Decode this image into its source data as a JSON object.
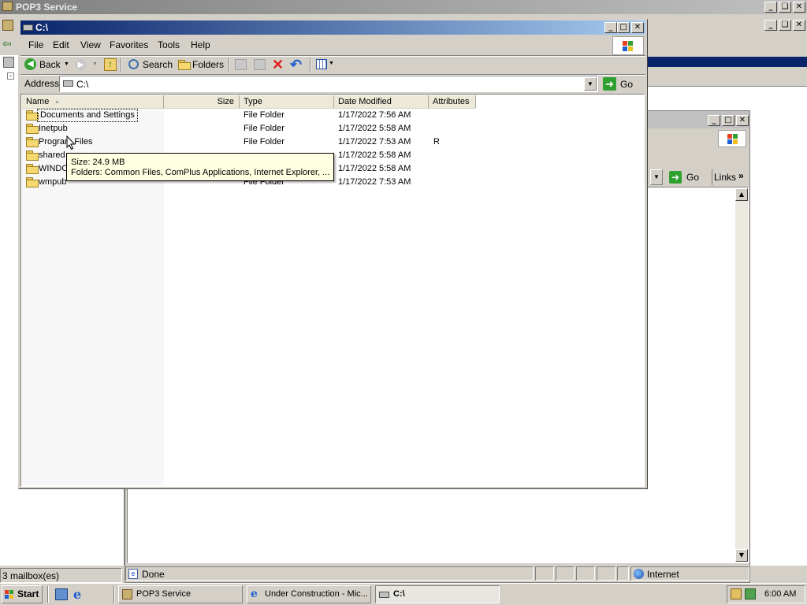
{
  "pop3_window": {
    "title": "POP3 Service",
    "status": "3 mailbox(es)"
  },
  "explorer": {
    "title": "C:\\",
    "menu": [
      "File",
      "Edit",
      "View",
      "Favorites",
      "Tools",
      "Help"
    ],
    "toolbar": {
      "back_label": "Back",
      "search_label": "Search",
      "folders_label": "Folders"
    },
    "address": {
      "label": "Address",
      "value": "C:\\",
      "go_label": "Go"
    },
    "columns": [
      "Name",
      "Size",
      "Type",
      "Date Modified",
      "Attributes"
    ],
    "rows": [
      {
        "name": "Documents and Settings",
        "size": "",
        "type": "File Folder",
        "modified": "1/17/2022 7:56 AM",
        "attributes": ""
      },
      {
        "name": "Inetpub",
        "size": "",
        "type": "File Folder",
        "modified": "1/17/2022 5:58 AM",
        "attributes": ""
      },
      {
        "name": "Program Files",
        "size": "",
        "type": "File Folder",
        "modified": "1/17/2022 7:53 AM",
        "attributes": "R"
      },
      {
        "name": "shared",
        "size": "",
        "type": "",
        "modified": "1/17/2022 5:58 AM",
        "attributes": ""
      },
      {
        "name": "WINDO",
        "size": "",
        "type": "",
        "modified": "1/17/2022 5:58 AM",
        "attributes": ""
      },
      {
        "name": "wmpub",
        "size": "",
        "type": "File Folder",
        "modified": "1/17/2022 7:53 AM",
        "attributes": ""
      }
    ],
    "tooltip": {
      "line1": "Size: 24.9 MB",
      "line2": "Folders: Common Files, ComPlus Applications, Internet Explorer, ..."
    }
  },
  "ie_window": {
    "go_label": "Go",
    "links_label": "Links",
    "status_text": "Done",
    "zone_text": "Internet"
  },
  "taskbar": {
    "start_label": "Start",
    "buttons": [
      "POP3 Service",
      "Under Construction - Mic...",
      "C:\\"
    ],
    "clock": "6:00 AM"
  },
  "colors": {
    "title_active_start": "#0a246a",
    "title_active_end": "#a6caf0",
    "title_inactive": "#808080",
    "face": "#d4d0c8",
    "tooltip_bg": "#ffffe1"
  }
}
